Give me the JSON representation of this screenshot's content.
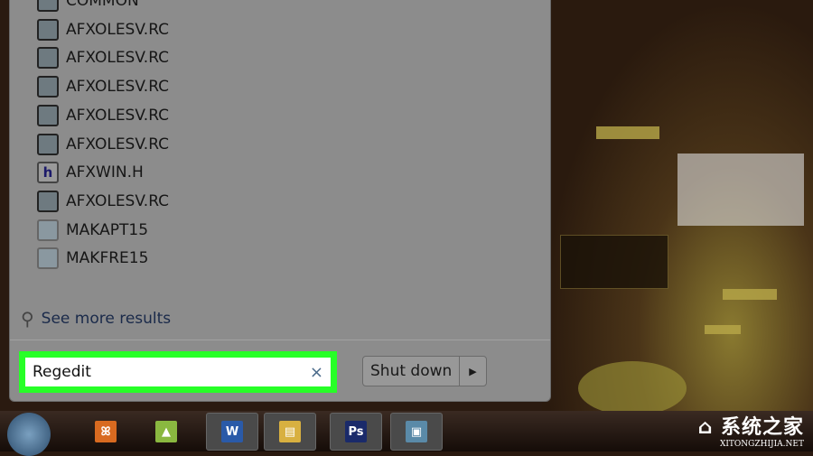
{
  "start_menu": {
    "results": [
      {
        "label": "COMMON",
        "icon": "folder-icon"
      },
      {
        "label": "AFXOLESV.RC",
        "icon": "resource-file-icon"
      },
      {
        "label": "AFXOLESV.RC",
        "icon": "resource-file-icon"
      },
      {
        "label": "AFXOLESV.RC",
        "icon": "resource-file-icon"
      },
      {
        "label": "AFXOLESV.RC",
        "icon": "resource-file-icon"
      },
      {
        "label": "AFXOLESV.RC",
        "icon": "resource-file-icon"
      },
      {
        "label": "AFXWIN.H",
        "icon": "header-file-icon"
      },
      {
        "label": "AFXOLESV.RC",
        "icon": "resource-file-icon"
      },
      {
        "label": "MAKAPT15",
        "icon": "settings-file-icon"
      },
      {
        "label": "MAKFRE15",
        "icon": "settings-file-icon"
      }
    ],
    "see_more": "See more results",
    "search_value": "Regedit",
    "clear_symbol": "×",
    "shutdown_label": "Shut down",
    "shutdown_arrow": "▶"
  },
  "taskbar": {
    "apps": [
      {
        "name": "xampp",
        "glyph": "ꕤ",
        "color": "#d86a20"
      },
      {
        "name": "android",
        "glyph": "▲",
        "color": "#8ab840"
      },
      {
        "name": "word",
        "glyph": "W",
        "color": "#2a5aa8"
      },
      {
        "name": "explorer",
        "glyph": "▤",
        "color": "#d8b040"
      },
      {
        "name": "photoshop",
        "glyph": "Ps",
        "color": "#1a2a6a"
      },
      {
        "name": "picture-viewer",
        "glyph": "▣",
        "color": "#5a8aa8"
      }
    ]
  },
  "watermark": {
    "cn": "系统之家",
    "en": "XITONGZHIJIA.NET"
  },
  "colors": {
    "highlight": "#27ff27"
  }
}
